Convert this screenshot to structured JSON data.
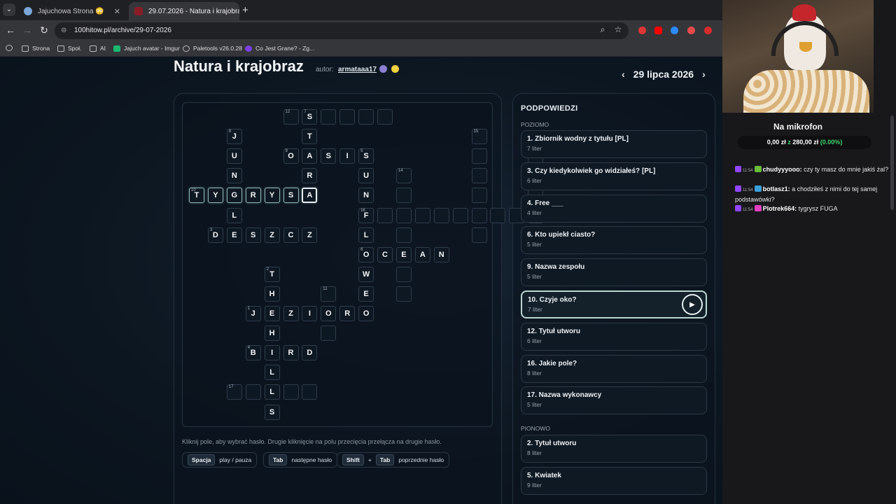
{
  "browser": {
    "tabs": [
      {
        "label": "Jajuchowa Strona 😳",
        "active": false
      },
      {
        "label": "29.07.2026 - Natura i krajobraz",
        "active": true
      }
    ],
    "url": "100hitow.pl/archive/29-07-2026",
    "bookmarks": [
      "Strona",
      "Społ.",
      "AI",
      "Jajuch avatar - Imgur",
      "Paletools v26.0.28",
      "Co Jest Grane? - Zg..."
    ]
  },
  "puzzle": {
    "title": "Natura i krajobraz",
    "author_label": "autor:",
    "author": "armataaa17",
    "date": "29 lipca 2026"
  },
  "grid": {
    "cells": [
      {
        "c": 5,
        "r": 0,
        "n": "12"
      },
      {
        "c": 6,
        "r": 0,
        "n": "7",
        "ch": "S"
      },
      {
        "c": 7,
        "r": 0
      },
      {
        "c": 8,
        "r": 0
      },
      {
        "c": 9,
        "r": 0
      },
      {
        "c": 10,
        "r": 0
      },
      {
        "c": 2,
        "r": 1,
        "n": "8",
        "ch": "J"
      },
      {
        "c": 6,
        "r": 1,
        "ch": "T"
      },
      {
        "c": 15,
        "r": 1,
        "n": "15"
      },
      {
        "c": 2,
        "r": 2,
        "ch": "U"
      },
      {
        "c": 5,
        "r": 2,
        "n": "9",
        "ch": "O"
      },
      {
        "c": 6,
        "r": 2,
        "ch": "A"
      },
      {
        "c": 7,
        "r": 2,
        "ch": "S"
      },
      {
        "c": 8,
        "r": 2,
        "ch": "I"
      },
      {
        "c": 9,
        "r": 2,
        "n": "5",
        "ch": "S"
      },
      {
        "c": 15,
        "r": 2
      },
      {
        "c": 18,
        "r": 2,
        "n": "13"
      },
      {
        "c": 2,
        "r": 3,
        "ch": "N"
      },
      {
        "c": 6,
        "r": 3,
        "ch": "R"
      },
      {
        "c": 9,
        "r": 3,
        "ch": "U"
      },
      {
        "c": 11,
        "r": 3,
        "n": "14"
      },
      {
        "c": 15,
        "r": 3
      },
      {
        "c": 18,
        "r": 3
      },
      {
        "c": 0,
        "r": 4,
        "n": "10",
        "ch": "T",
        "hl": true
      },
      {
        "c": 1,
        "r": 4,
        "ch": "Y",
        "hl": true
      },
      {
        "c": 2,
        "r": 4,
        "ch": "G",
        "hl": true
      },
      {
        "c": 3,
        "r": 4,
        "ch": "R",
        "hl": true
      },
      {
        "c": 4,
        "r": 4,
        "ch": "Y",
        "hl": true
      },
      {
        "c": 5,
        "r": 4,
        "ch": "S",
        "hl": true
      },
      {
        "c": 6,
        "r": 4,
        "ch": "A",
        "hl": true,
        "sel": true
      },
      {
        "c": 9,
        "r": 4,
        "ch": "N"
      },
      {
        "c": 11,
        "r": 4
      },
      {
        "c": 15,
        "r": 4
      },
      {
        "c": 18,
        "r": 4
      },
      {
        "c": 2,
        "r": 5,
        "ch": "L"
      },
      {
        "c": 9,
        "r": 5,
        "n": "16",
        "ch": "F"
      },
      {
        "c": 10,
        "r": 5
      },
      {
        "c": 11,
        "r": 5
      },
      {
        "c": 12,
        "r": 5
      },
      {
        "c": 13,
        "r": 5
      },
      {
        "c": 14,
        "r": 5
      },
      {
        "c": 15,
        "r": 5
      },
      {
        "c": 16,
        "r": 5
      },
      {
        "c": 17,
        "r": 5
      },
      {
        "c": 18,
        "r": 5
      },
      {
        "c": 1,
        "r": 6,
        "n": "3",
        "ch": "D"
      },
      {
        "c": 2,
        "r": 6,
        "ch": "E"
      },
      {
        "c": 3,
        "r": 6,
        "ch": "S"
      },
      {
        "c": 4,
        "r": 6,
        "ch": "Z"
      },
      {
        "c": 5,
        "r": 6,
        "ch": "C"
      },
      {
        "c": 6,
        "r": 6,
        "ch": "Z"
      },
      {
        "c": 9,
        "r": 6,
        "ch": "L"
      },
      {
        "c": 11,
        "r": 6
      },
      {
        "c": 15,
        "r": 6
      },
      {
        "c": 18,
        "r": 6
      },
      {
        "c": 9,
        "r": 7,
        "n": "6",
        "ch": "O"
      },
      {
        "c": 10,
        "r": 7,
        "ch": "C"
      },
      {
        "c": 11,
        "r": 7,
        "ch": "E"
      },
      {
        "c": 12,
        "r": 7,
        "ch": "A"
      },
      {
        "c": 13,
        "r": 7,
        "ch": "N"
      },
      {
        "c": 4,
        "r": 8,
        "n": "2",
        "ch": "T"
      },
      {
        "c": 9,
        "r": 8,
        "ch": "W"
      },
      {
        "c": 11,
        "r": 8
      },
      {
        "c": 4,
        "r": 9,
        "ch": "H"
      },
      {
        "c": 7,
        "r": 9,
        "n": "11"
      },
      {
        "c": 9,
        "r": 9,
        "ch": "E"
      },
      {
        "c": 11,
        "r": 9
      },
      {
        "c": 3,
        "r": 10,
        "n": "1",
        "ch": "J"
      },
      {
        "c": 4,
        "r": 10,
        "ch": "E"
      },
      {
        "c": 5,
        "r": 10,
        "ch": "Z"
      },
      {
        "c": 6,
        "r": 10,
        "ch": "I"
      },
      {
        "c": 7,
        "r": 10,
        "ch": "O"
      },
      {
        "c": 8,
        "r": 10,
        "ch": "R"
      },
      {
        "c": 9,
        "r": 10,
        "ch": "O"
      },
      {
        "c": 4,
        "r": 11,
        "ch": "H"
      },
      {
        "c": 7,
        "r": 11
      },
      {
        "c": 3,
        "r": 12,
        "n": "4",
        "ch": "B"
      },
      {
        "c": 4,
        "r": 12,
        "ch": "I"
      },
      {
        "c": 5,
        "r": 12,
        "ch": "R"
      },
      {
        "c": 6,
        "r": 12,
        "ch": "D"
      },
      {
        "c": 4,
        "r": 13,
        "ch": "L"
      },
      {
        "c": 2,
        "r": 14,
        "n": "17"
      },
      {
        "c": 3,
        "r": 14
      },
      {
        "c": 4,
        "r": 14,
        "ch": "L"
      },
      {
        "c": 5,
        "r": 14
      },
      {
        "c": 6,
        "r": 14
      },
      {
        "c": 4,
        "r": 15,
        "ch": "S"
      }
    ]
  },
  "help": {
    "hint": "Kliknij pole, aby wybrać hasło. Drugie kliknięcie na polu przecięcia przełącza na drugie hasło.",
    "shortcuts": [
      {
        "keys": [
          "Spacja"
        ],
        "label": "play / pauza"
      },
      {
        "keys": [
          "Tab"
        ],
        "label": "następne hasło"
      },
      {
        "keys": [
          "Shift",
          "Tab"
        ],
        "sep": "+",
        "label": "poprzednie hasło"
      }
    ]
  },
  "clues": {
    "title": "PODPOWIEDZI",
    "across_label": "POZIOMO",
    "down_label": "PIONOWO",
    "across": [
      {
        "title": "1. Zbiornik wodny z tytułu [PL]",
        "count": "7 liter"
      },
      {
        "title": "3. Czy kiedykolwiek go widziałeś? [PL]",
        "count": "6 liter"
      },
      {
        "title": "4. Free ___",
        "count": "4 liter"
      },
      {
        "title": "6. Kto upiekł ciasto?",
        "count": "5 liter"
      },
      {
        "title": "9. Nazwa zespołu",
        "count": "5 liter"
      },
      {
        "title": "10. Czyje oko?",
        "count": "7 liter",
        "active": true
      },
      {
        "title": "12. Tytuł utworu",
        "count": "6 liter"
      },
      {
        "title": "16. Jakie pole?",
        "count": "8 liter"
      },
      {
        "title": "17. Nazwa wykonawcy",
        "count": "5 liter"
      }
    ],
    "down": [
      {
        "title": "2. Tytuł utworu",
        "count": "8 liter"
      },
      {
        "title": "5. Kwiatek",
        "count": "9 liter"
      }
    ]
  },
  "stream": {
    "mic_title": "Na mikrofon",
    "mic_amount": "0,00 zł",
    "mic_of": "z",
    "mic_goal": "280,00 zł",
    "mic_pct": "(0.00%)",
    "chat": [
      {
        "time": "11:54",
        "user": "chudyyyooo:",
        "msg": "czy ty masz do mnie jakiś żal?"
      },
      {
        "time": "11:54",
        "user": "botlasz1:",
        "msg": "a chodziłeś z nimi do tej samej podstawówki?"
      },
      {
        "time": "11:54",
        "user": "Plotrek664:",
        "msg": "tygrysz FUGA"
      }
    ]
  },
  "colors": {
    "accent": "#b9d6cf",
    "background": "#0c1620",
    "twitch": "#9147ff",
    "green": "#3fd66b"
  }
}
